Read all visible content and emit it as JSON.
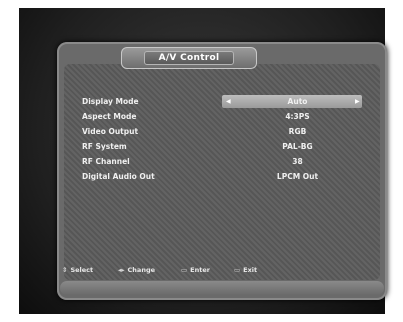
{
  "header": {
    "title": "A/V Control"
  },
  "settings": [
    {
      "label": "Display Mode",
      "value": "Auto"
    },
    {
      "label": "Aspect Mode",
      "value": "4:3PS"
    },
    {
      "label": "Video Output",
      "value": "RGB"
    },
    {
      "label": "RF System",
      "value": "PAL-BG"
    },
    {
      "label": "RF Channel",
      "value": "38"
    },
    {
      "label": "Digital Audio Out",
      "value": "LPCM Out"
    }
  ],
  "selected_index": 0,
  "footer": {
    "select": "Select",
    "change": "Change",
    "enter": "Enter",
    "exit": "Exit"
  },
  "colors": {
    "panel": "#5b5b5b",
    "highlight": "#b0b0b0",
    "text": "#f0f0f0"
  },
  "icons": {
    "left": "left-arrow-icon",
    "right": "right-arrow-icon"
  }
}
